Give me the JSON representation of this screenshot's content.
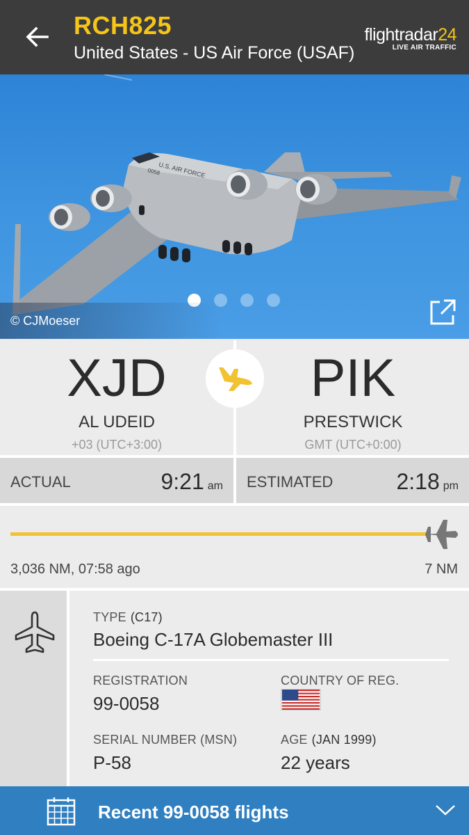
{
  "header": {
    "callsign": "RCH825",
    "operator": "United States - US Air Force (USAF)",
    "brand_name": "flightradar",
    "brand_num": "24",
    "brand_sub": "LIVE AIR TRAFFIC"
  },
  "photo": {
    "credit": "© CJMoeser",
    "aircraft_marking": "U.S. AIR FORCE",
    "tail_number": "0058",
    "pages": 4,
    "active_page": 1
  },
  "route": {
    "from": {
      "iata": "XJD",
      "city": "AL UDEID",
      "tz": "+03 (UTC+3:00)"
    },
    "to": {
      "iata": "PIK",
      "city": "PRESTWICK",
      "tz": "GMT (UTC+0:00)"
    }
  },
  "times": {
    "actual_label": "ACTUAL",
    "actual_time": "9:21",
    "actual_ampm": "am",
    "est_label": "ESTIMATED",
    "est_time": "2:18",
    "est_ampm": "pm"
  },
  "progress": {
    "fraction": 0.998,
    "left_text": "3,036 NM, 07:58 ago",
    "right_text": "7 NM"
  },
  "aircraft": {
    "type_label": "TYPE",
    "type_code": "(C17)",
    "type_value": "Boeing C-17A Globemaster III",
    "reg_label": "REGISTRATION",
    "reg_value": "99-0058",
    "country_label": "COUNTRY OF REG.",
    "country_flag": "us-flag",
    "msn_label": "SERIAL NUMBER (MSN)",
    "msn_value": "P-58",
    "age_label": "AGE",
    "age_date": "(JAN 1999)",
    "age_value": "22 years"
  },
  "bottom_bar": {
    "label": "Recent 99-0058 flights"
  },
  "colors": {
    "header_bg": "#3c3c3c",
    "accent_yellow": "#f5c518",
    "bottom_bar": "#2f7fc1"
  }
}
